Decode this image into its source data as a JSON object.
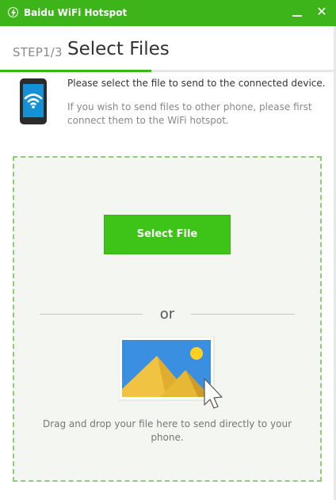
{
  "window": {
    "title": "Baidu WiFi Hotspot",
    "minimize_icon": "minimize-icon",
    "close_icon": "close-icon",
    "close_glyph": "✕",
    "accent_color": "#3db51a"
  },
  "step": {
    "label": "STEP1/3",
    "title": "Select Files",
    "progress": 0.45
  },
  "info": {
    "icon": "phone-wifi-icon",
    "primary": "Please select the file to send to the connected device.",
    "secondary": "If you wish to send files to other phone, please first connect them to the WiFi hotspot."
  },
  "drop_zone": {
    "select_button": "Select File",
    "or_text": "or",
    "image_icon": "image-drop-icon",
    "drag_text": "Drag and drop your file here to send directly to your phone."
  }
}
